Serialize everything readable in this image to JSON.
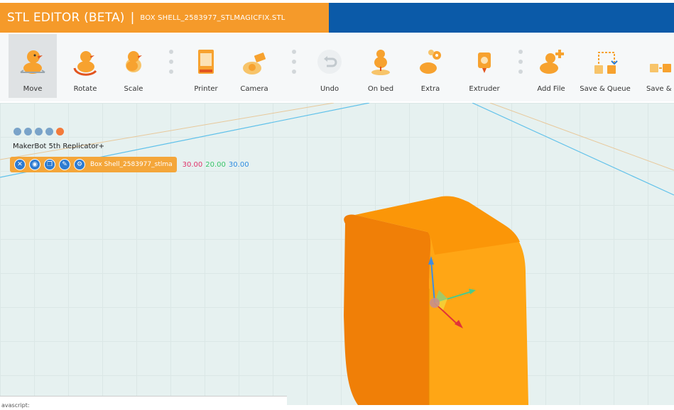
{
  "header": {
    "app_title": "STL EDITOR (BETA)",
    "separator": "|",
    "file_name": "BOX SHELL_2583977_STLMAGICFIX.STL",
    "colors": {
      "orange": "#f59a2a",
      "blue": "#0b5aa8"
    }
  },
  "toolbar": {
    "items": [
      {
        "label": "Move",
        "icon": "duck-move-icon",
        "active": true
      },
      {
        "label": "Rotate",
        "icon": "duck-rotate-icon"
      },
      {
        "label": "Scale",
        "icon": "duck-scale-icon"
      },
      {
        "label": "Printer",
        "icon": "printer-icon"
      },
      {
        "label": "Camera",
        "icon": "camera-icon"
      },
      {
        "label": "Undo",
        "icon": "undo-icon"
      },
      {
        "label": "On bed",
        "icon": "duck-on-bed-icon"
      },
      {
        "label": "Extra",
        "icon": "gears-icon"
      },
      {
        "label": "Extruder",
        "icon": "extruder-icon"
      },
      {
        "label": "Add File",
        "icon": "add-file-icon"
      },
      {
        "label": "Save & Queue",
        "icon": "save-queue-icon"
      },
      {
        "label": "Save & S",
        "icon": "save-icon"
      }
    ]
  },
  "viewport": {
    "mini_icons": [
      "ruler-icon",
      "grid-icon",
      "layers-icon",
      "camera-view-icon",
      "support-icon"
    ],
    "printer_name": "MakerBot 5th Replicator+",
    "object": {
      "name": "Box Shell_2583977_stlma",
      "buttons": [
        "close-icon",
        "eye-icon",
        "duplicate-icon",
        "edit-icon",
        "settings-icon"
      ],
      "dim_x": "30.00",
      "dim_y": "20.00",
      "dim_z": "30.00"
    }
  },
  "status": {
    "text": "avascript:"
  }
}
